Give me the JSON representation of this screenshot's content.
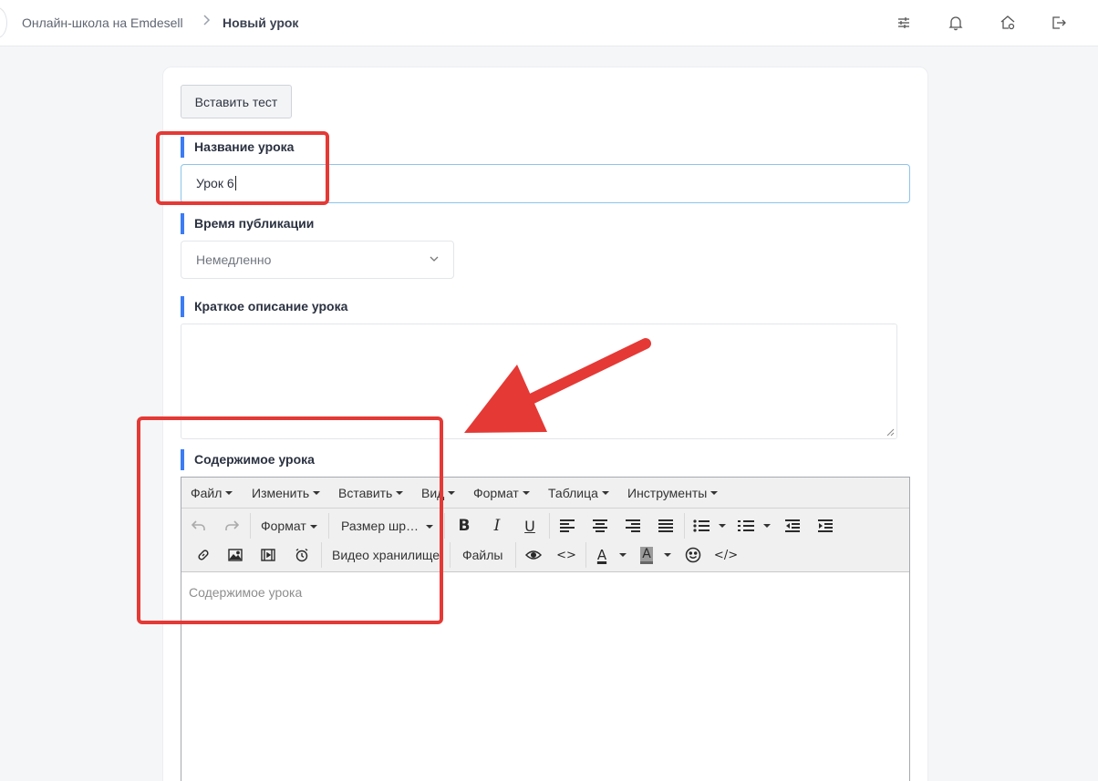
{
  "breadcrumb": {
    "school": "Онлайн-школа на Emdesell",
    "separator": ">",
    "current": "Новый урок"
  },
  "header_icons": [
    "sliders-icon",
    "bell-icon",
    "home-settings-icon",
    "logout-icon"
  ],
  "form": {
    "insert_test_button": "Вставить тест",
    "title_label": "Название урока",
    "title_value": "Урок 6",
    "publish_label": "Время публикации",
    "publish_value": "Немедленно",
    "description_label": "Краткое описание урока",
    "description_value": "",
    "content_label": "Содержимое урока",
    "content_placeholder": "Содержимое урока"
  },
  "editor": {
    "menus": [
      "Файл",
      "Изменить",
      "Вставить",
      "Вид",
      "Формат",
      "Таблица",
      "Инструменты"
    ],
    "format_dropdown": "Формат",
    "font_size_dropdown": "Размер шр…",
    "video_storage_button": "Видео хранилище",
    "files_button": "Файлы",
    "bold_glyph": "B",
    "italic_glyph": "I",
    "underline_glyph": "U",
    "text_color_glyph": "A",
    "bg_color_glyph": "A",
    "code_glyph": "<>",
    "source_glyph": "</>"
  },
  "colors": {
    "accent": "#3b7cf6",
    "annotation": "#e53935",
    "input_focus_border": "#8cc4ea"
  }
}
